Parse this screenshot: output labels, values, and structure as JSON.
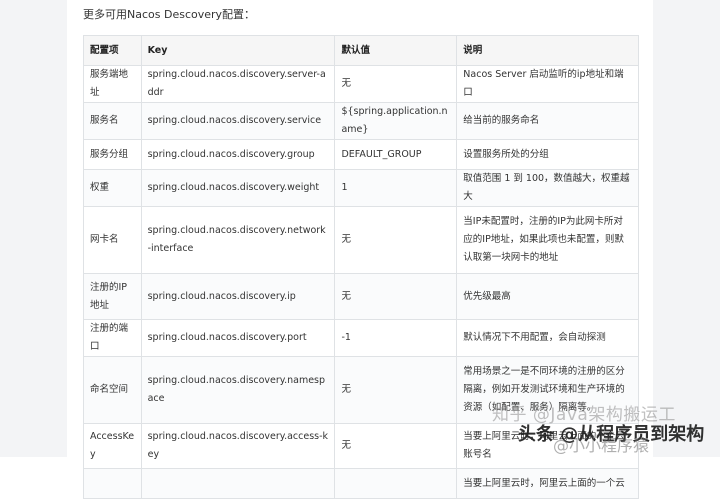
{
  "intro": "更多可用Nacos Descovery配置：",
  "table": {
    "headers": [
      "配置项",
      "Key",
      "默认值",
      "说明"
    ],
    "rows": [
      [
        "服务端地址",
        "spring.cloud.nacos.discovery.server-addr",
        "无",
        "Nacos Server 启动监听的ip地址和端口"
      ],
      [
        "服务名",
        "spring.cloud.nacos.discovery.service",
        "${spring.application.name}",
        "给当前的服务命名"
      ],
      [
        "服务分组",
        "spring.cloud.nacos.discovery.group",
        "DEFAULT_GROUP",
        "设置服务所处的分组"
      ],
      [
        "权重",
        "spring.cloud.nacos.discovery.weight",
        "1",
        "取值范围 1 到 100，数值越大，权重越大"
      ],
      [
        "网卡名",
        "spring.cloud.nacos.discovery.network-interface",
        "无",
        "当IP未配置时，注册的IP为此网卡所对应的IP地址，如果此项也未配置，则默认取第一块网卡的地址"
      ],
      [
        "注册的IP地址",
        "spring.cloud.nacos.discovery.ip",
        "无",
        "优先级最高"
      ],
      [
        "注册的端口",
        "spring.cloud.nacos.discovery.port",
        "-1",
        "默认情况下不用配置，会自动探测"
      ],
      [
        "命名空间",
        "spring.cloud.nacos.discovery.namespace",
        "无",
        "常用场景之一是不同环境的注册的区分隔离，例如开发测试环境和生产环境的资源（如配置、服务）隔离等。"
      ],
      [
        "AccessKey",
        "spring.cloud.nacos.discovery.access-key",
        "无",
        "当要上阿里云时，阿里云上面的一个云账号名"
      ],
      [
        "",
        "",
        "",
        "当要上阿里云时，阿里云上面的一个云"
      ]
    ]
  },
  "watermarks": [
    "知乎 @Java架构搬运工",
    "头条 @从程序员到架构",
    "@小小程序猿"
  ]
}
